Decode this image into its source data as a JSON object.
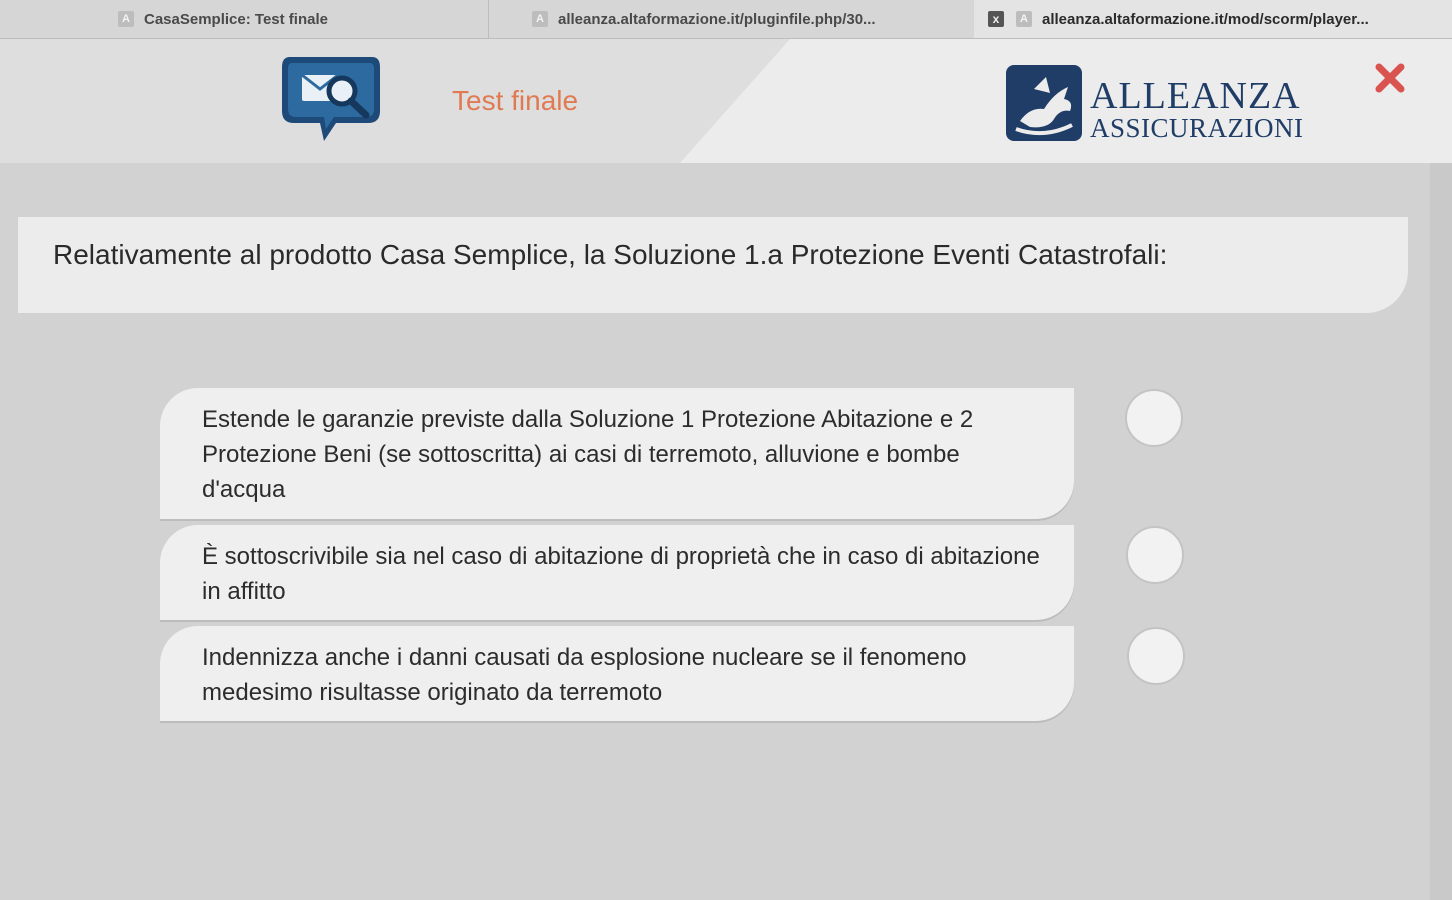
{
  "tabs": [
    {
      "favicon": "A",
      "title": "CasaSemplice: Test finale"
    },
    {
      "favicon": "A",
      "title": "alleanza.altaformazione.it/pluginfile.php/30..."
    },
    {
      "favicon": "A",
      "title": "alleanza.altaformazione.it/mod/scorm/player...",
      "close_glyph": "x"
    }
  ],
  "header": {
    "icon": "speech-bubble-magnifier-icon",
    "title": "Test finale",
    "logo": {
      "line1": "ALLEANZA",
      "line2": "ASSICURAZIONI"
    },
    "close_icon": "close-icon"
  },
  "question": {
    "text": "Relativamente al prodotto Casa Semplice, la Soluzione 1.a Protezione Eventi Catastrofali:"
  },
  "answers": [
    {
      "text": "Estende le garanzie previste dalla Soluzione 1 Protezione Abitazione e 2 Protezione Beni (se sottoscritta) ai casi di terremoto, alluvione e bombe d'acqua",
      "selected": false
    },
    {
      "text": "È sottoscrivibile sia nel caso di abitazione di proprietà che in caso di abitazione in affitto",
      "selected": false
    },
    {
      "text": "Indennizza anche i danni causati da esplosione nucleare se il fenomeno medesimo risultasse originato da terremoto",
      "selected": false
    }
  ],
  "colors": {
    "title": "#e07a52",
    "brand": "#1f3d66",
    "close": "#d9534f"
  }
}
